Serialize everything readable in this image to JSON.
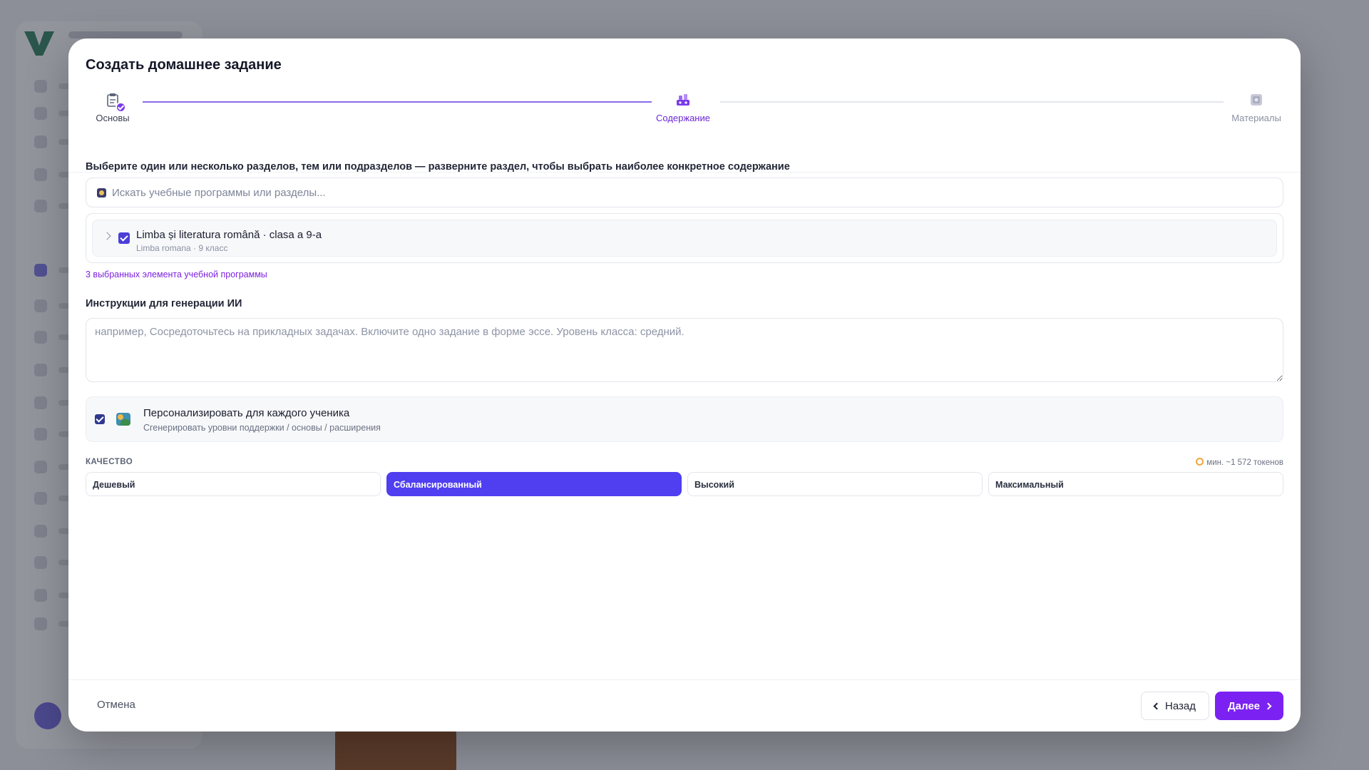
{
  "modal": {
    "title": "Создать домашнее задание"
  },
  "stepper": {
    "steps": [
      {
        "label": "Основы",
        "icon": "clipboard-icon",
        "state": "completed"
      },
      {
        "label": "Содержание",
        "icon": "content-icon",
        "state": "active"
      },
      {
        "label": "Материалы",
        "icon": "materials-icon",
        "state": "pending"
      }
    ]
  },
  "content": {
    "section_label": "Выберите один или несколько разделов, тем или подразделов — разверните раздел, чтобы выбрать наиболее конкретное содержание",
    "search_placeholder": "Искать учебные программы или разделы...",
    "curriculum": {
      "title": "Limba și literatura română · clasa a 9-a",
      "subtitle": "Limba romana · 9 класс",
      "checked": true
    },
    "selected_count": "3 выбранных элемента учебной программы",
    "instructions_label": "Инструкции для генерации ИИ",
    "instructions_placeholder": "например, Сосредоточьтесь на прикладных задачах. Включите одно задание в форме эссе. Уровень класса: средний.",
    "personalize": {
      "title": "Персонализировать для каждого ученика",
      "subtitle": "Сгенерировать уровни поддержки / основы / расширения",
      "checked": true
    },
    "quality": {
      "label": "КАЧЕСТВО",
      "tokens": "мин. ~1 572 токенов",
      "options": [
        "Дешевый",
        "Сбалансированный",
        "Высокий",
        "Максимальный"
      ],
      "selected": "Сбалансированный"
    }
  },
  "footer": {
    "cancel_label": "Отмена",
    "back_label": "Назад",
    "next_label": "Далее"
  },
  "colors": {
    "accent": "#7b22f2",
    "selected_option": "#4f3ff0",
    "checkbox": "#4b3fd8"
  }
}
